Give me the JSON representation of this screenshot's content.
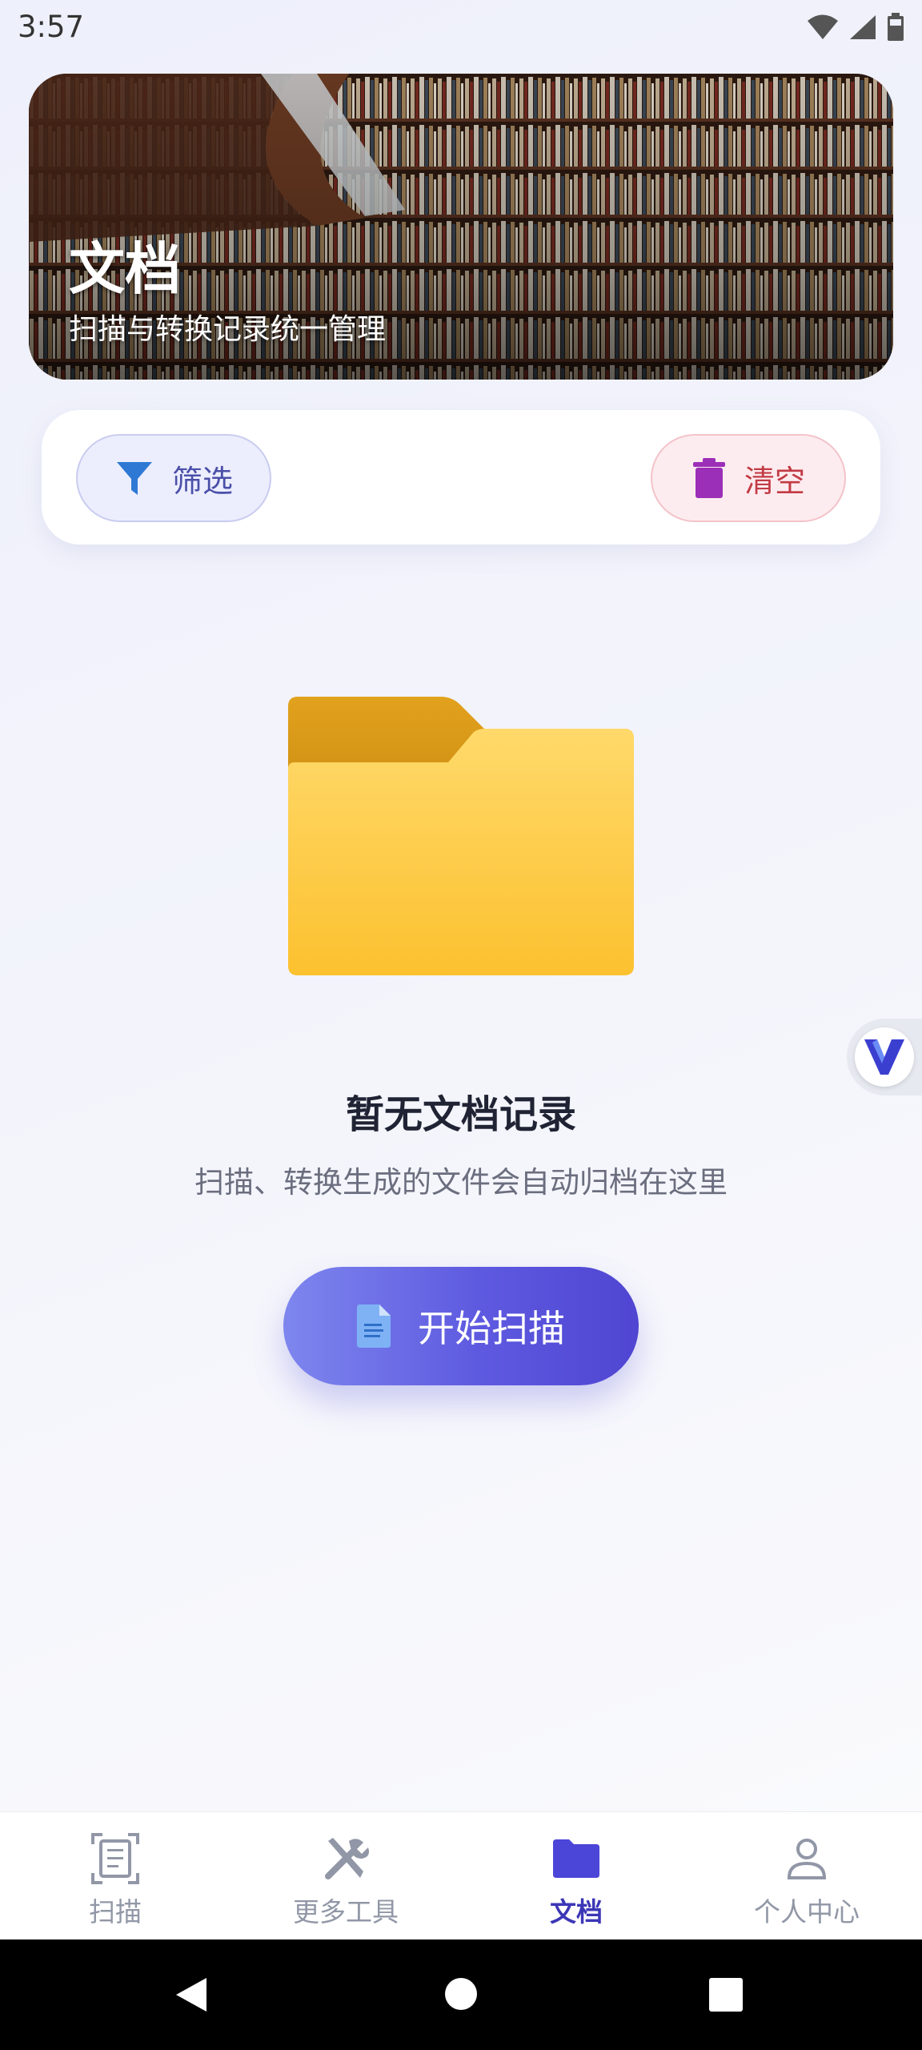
{
  "status_bar": {
    "time": "3:57"
  },
  "banner": {
    "title": "文档",
    "subtitle": "扫描与转换记录统一管理"
  },
  "actions": {
    "filter_label": "筛选",
    "clear_label": "清空"
  },
  "empty_state": {
    "title": "暂无文档记录",
    "description": "扫描、转换生成的文件会自动归档在这里",
    "start_button": "开始扫描"
  },
  "bottom_nav": {
    "items": [
      {
        "label": "扫描",
        "icon": "scan-icon",
        "active": false
      },
      {
        "label": "更多工具",
        "icon": "tools-icon",
        "active": false
      },
      {
        "label": "文档",
        "icon": "folder-icon",
        "active": true
      },
      {
        "label": "个人中心",
        "icon": "person-icon",
        "active": false
      }
    ]
  },
  "colors": {
    "accent": "#4f45d2",
    "nav_active": "#3c37b6",
    "nav_inactive": "#9197a6",
    "folder": "#fcc63a",
    "clear_red": "#c23b45"
  }
}
